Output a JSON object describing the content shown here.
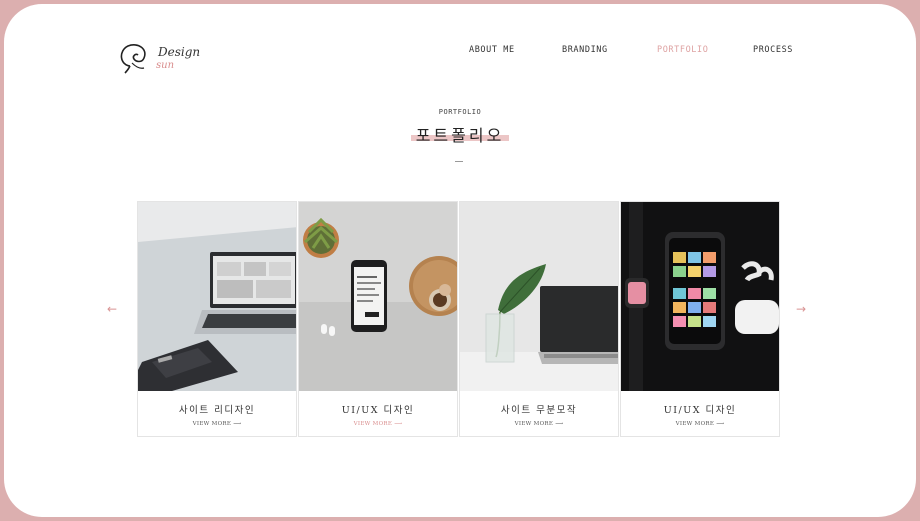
{
  "logo": {
    "line1": "Design",
    "line2": "sun"
  },
  "nav": [
    {
      "label": "ABOUT ME",
      "active": false
    },
    {
      "label": "BRANDING",
      "active": false
    },
    {
      "label": "PORTFOLIO",
      "active": true
    },
    {
      "label": "PROCESS",
      "active": false
    }
  ],
  "section": {
    "label": "PORTFOLIO",
    "title": "포트폴리오"
  },
  "arrows": {
    "prev": "←",
    "next": "→"
  },
  "cards": [
    {
      "caption": "사이트 리디자인",
      "more": "VIEW MORE ⟶",
      "image": "laptop-desk-photo",
      "more_active": false
    },
    {
      "caption": "UI/UX 디자인",
      "more": "VIEW MORE ⟶",
      "image": "phone-plant-photo",
      "more_active": true
    },
    {
      "caption": "사이트 무분모작",
      "more": "VIEW MORE ⟶",
      "image": "laptop-leaf-photo",
      "more_active": false
    },
    {
      "caption": "UI/UX 디자인",
      "more": "VIEW MORE ⟶",
      "image": "phone-watch-airpods-photo",
      "more_active": false
    }
  ],
  "colors": {
    "accent": "#dea2a2",
    "frame": "#dcafaf",
    "text": "#333333"
  }
}
